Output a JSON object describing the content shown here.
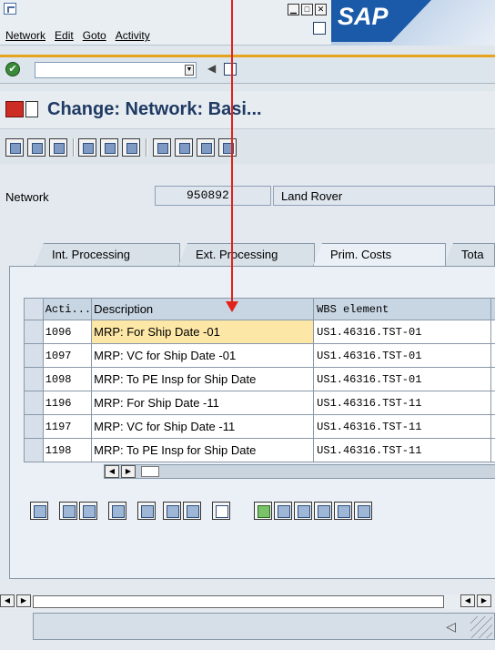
{
  "menubar": {
    "items": [
      "Network",
      "Edit",
      "Goto",
      "Activity"
    ],
    "window_controls": [
      "minimize",
      "maximize",
      "close"
    ],
    "logo_text": "SAP"
  },
  "title": {
    "text": "Change: Network: Basi..."
  },
  "network": {
    "label": "Network",
    "number": "950892",
    "description": "Land Rover"
  },
  "tabs": [
    {
      "label": "Int. Processing",
      "active": false
    },
    {
      "label": "Ext. Processing",
      "active": false
    },
    {
      "label": "Prim. Costs",
      "active": true
    },
    {
      "label": "Tota",
      "active": false
    }
  ],
  "table": {
    "headers": [
      "Acti...",
      "Description",
      "WBS element"
    ],
    "rows": [
      {
        "activity": "1096",
        "description": "MRP: For Ship Date -01",
        "wbs": "US1.46316.TST-01"
      },
      {
        "activity": "1097",
        "description": "MRP: VC for Ship Date -01",
        "wbs": "US1.46316.TST-01"
      },
      {
        "activity": "1098",
        "description": "MRP: To PE Insp for Ship Date",
        "wbs": "US1.46316.TST-01"
      },
      {
        "activity": "1196",
        "description": "MRP: For Ship Date -11",
        "wbs": "US1.46316.TST-11"
      },
      {
        "activity": "1197",
        "description": "MRP: VC for Ship Date -11",
        "wbs": "US1.46316.TST-11"
      },
      {
        "activity": "1198",
        "description": "MRP: To PE Insp for Ship Date",
        "wbs": "US1.46316.TST-11"
      }
    ]
  },
  "colors": {
    "selected_cell": "#fde7a6",
    "annotation_arrow": "#e3211b",
    "title_text": "#1f3a63",
    "accent": "#e5a41c"
  }
}
